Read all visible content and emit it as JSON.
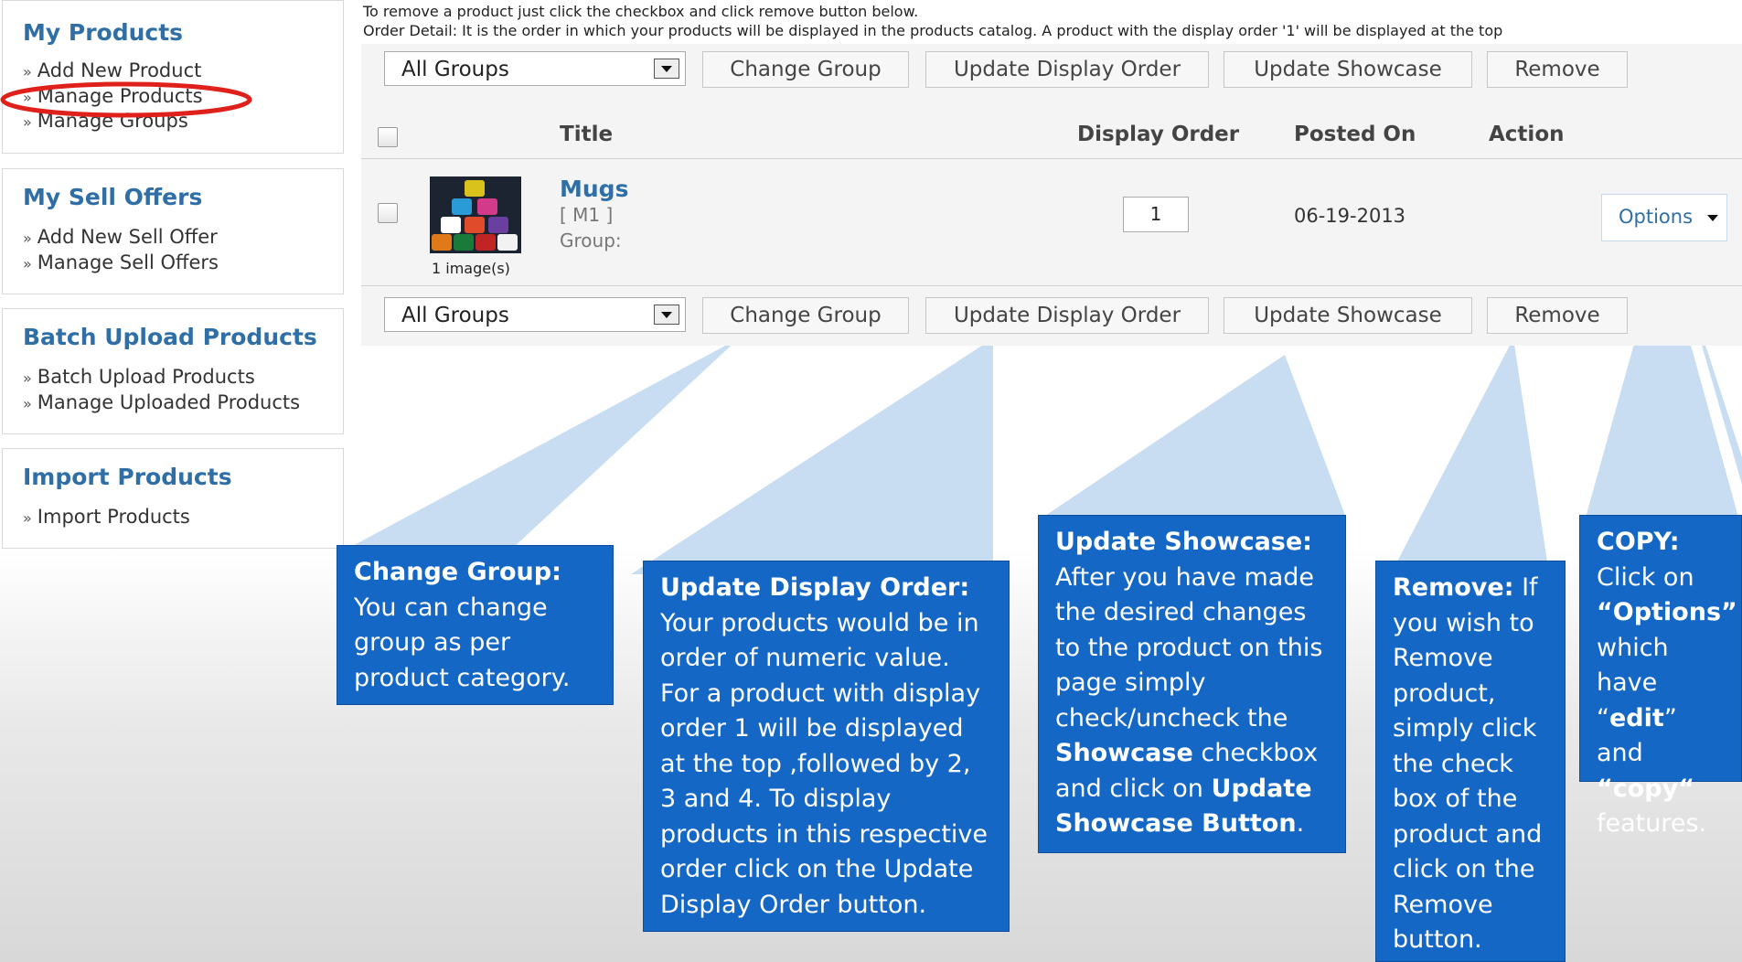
{
  "sidebar": {
    "my_products": {
      "title": "My Products",
      "links": [
        "Add New Product",
        "Manage Products",
        "Manage Groups"
      ]
    },
    "my_sell_offers": {
      "title": "My Sell Offers",
      "links": [
        "Add New Sell Offer",
        "Manage Sell Offers"
      ]
    },
    "batch_upload": {
      "title": "Batch Upload Products",
      "links": [
        "Batch Upload Products",
        "Manage Uploaded Products"
      ]
    },
    "import_products": {
      "title": "Import Products",
      "links": [
        "Import Products"
      ]
    },
    "link_prefix": "»"
  },
  "notes": {
    "line1": "To remove a product just click the checkbox and click remove button below.",
    "line2": "Order Detail: It is the order in which your products will be displayed in the products catalog. A product with the display order '1' will be displayed at the top"
  },
  "toolbar": {
    "group_select": "All Groups",
    "change_group": "Change Group",
    "update_display_order": "Update Display Order",
    "update_showcase": "Update Showcase",
    "remove": "Remove"
  },
  "table": {
    "columns": [
      "Title",
      "Display Order",
      "Posted On",
      "Action"
    ],
    "row": {
      "title": "Mugs",
      "code": "[ M1 ]",
      "group": "Group:",
      "images": "1 image(s)",
      "display_order": "1",
      "posted_on": "06-19-2013",
      "action": "Options"
    }
  },
  "callouts": {
    "change_group": {
      "head": "Change Group:",
      "body": " You can change group as per product category."
    },
    "update_display_order": {
      "head": "Update Display Order:",
      "body": " Your products would be in order of numeric value. For a product with display order 1 will be displayed at the top ,followed by 2, 3 and 4. To display products in this respective order click on the Update Display Order button."
    },
    "update_showcase": {
      "head": "Update Showcase:",
      "body1": " After you have made the desired changes to the product on this page simply check/uncheck the ",
      "bold1": "Showcase",
      "body2": " checkbox and  click on ",
      "bold2": "Update Showcase Button",
      "body3": "."
    },
    "remove": {
      "head": "Remove:",
      "body": " If you wish to Remove product, simply click the check box of the product and click on the Remove button."
    },
    "copy": {
      "head": "COPY:",
      "body1": " Click on ",
      "bold1": "“Options”",
      "body2": " which have “",
      "bold2": "edit",
      "body3": "” and ",
      "bold3": "“copy“",
      "body4": " features."
    }
  },
  "colors": {
    "callout": "#1467c5",
    "sidebar_title": "#2f6fa6",
    "highlight": "#e0201b"
  }
}
